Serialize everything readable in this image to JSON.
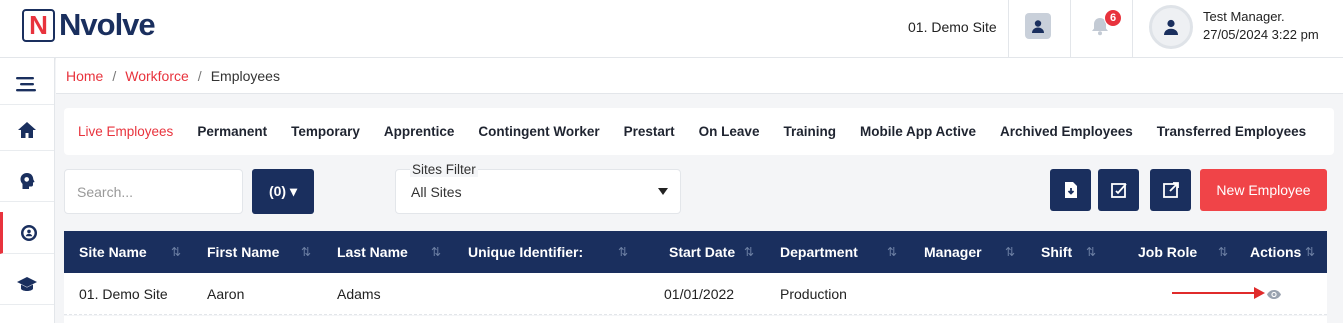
{
  "brand": {
    "logo_letter": "N",
    "logo_word": "Nvolve",
    "accent": "#e8333d",
    "navy": "#1a2f5e"
  },
  "header": {
    "site": "01. Demo Site",
    "notifications_count": "6",
    "user_name": "Test Manager.",
    "user_datetime": "27/05/2024 3:22 pm",
    "icons": [
      "profile-card-icon",
      "bell-icon",
      "user-avatar-icon"
    ]
  },
  "sidebar": {
    "items": [
      {
        "icon": "menu-icon"
      },
      {
        "icon": "home-icon"
      },
      {
        "icon": "head-gear-icon"
      },
      {
        "icon": "employee-gear-icon",
        "active": true
      },
      {
        "icon": "graduation-cap-icon"
      }
    ]
  },
  "breadcrumb": {
    "home": "Home",
    "sep": "/",
    "workforce": "Workforce",
    "current": "Employees"
  },
  "tabs": [
    "Live Employees",
    "Permanent",
    "Temporary",
    "Apprentice",
    "Contingent Worker",
    "Prestart",
    "On Leave",
    "Training",
    "Mobile App Active",
    "Archived Employees",
    "Transferred Employees"
  ],
  "toolbar": {
    "search_placeholder": "Search...",
    "count_label": "(0) ▾",
    "sites_filter_label": "Sites Filter",
    "sites_filter_value": "All Sites",
    "new_employee": "New Employee"
  },
  "table": {
    "columns": [
      "Site Name",
      "First Name",
      "Last Name",
      "Unique Identifier:",
      "Start Date",
      "Department",
      "Manager",
      "Shift",
      "Job Role",
      "Actions"
    ],
    "rows": [
      [
        "01. Demo Site",
        "Aaron",
        "Adams",
        "",
        "01/01/2022",
        "Production",
        "",
        "",
        "",
        "view-eye-icon"
      ]
    ]
  }
}
